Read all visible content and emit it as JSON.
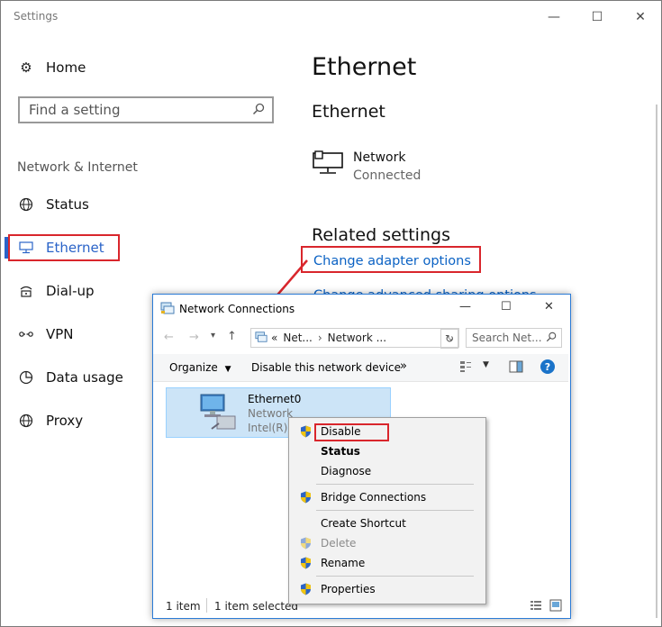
{
  "window": {
    "title": "Settings",
    "minimize": "—",
    "maximize": "☐",
    "close": "✕"
  },
  "sidebar": {
    "home_label": "Home",
    "search_placeholder": "Find a setting",
    "section_title": "Network & Internet",
    "items": [
      {
        "label": "Status",
        "icon": "globe-status-icon"
      },
      {
        "label": "Ethernet",
        "icon": "ethernet-icon",
        "selected": true
      },
      {
        "label": "Dial-up",
        "icon": "dialup-icon"
      },
      {
        "label": "VPN",
        "icon": "vpn-icon"
      },
      {
        "label": "Data usage",
        "icon": "data-usage-icon"
      },
      {
        "label": "Proxy",
        "icon": "globe-icon"
      }
    ]
  },
  "main": {
    "page_title": "Ethernet",
    "section_title": "Ethernet",
    "network_name": "Network",
    "network_status": "Connected",
    "related_title": "Related settings",
    "change_adapter_link": "Change adapter options",
    "partial_link": "Change advanced sharing options"
  },
  "network_connections": {
    "title": "Network Connections",
    "address_sep": "«",
    "address_parts": [
      "Net...",
      "Network ..."
    ],
    "search_placeholder": "Search Net...",
    "organize_label": "Organize",
    "disable_device_label": "Disable this network device",
    "more_label": "»",
    "adapter_name": "Ethernet0",
    "adapter_network": "Network",
    "adapter_device": "Intel(R) P",
    "status_count": "1 item",
    "status_selected": "1 item selected"
  },
  "context_menu": {
    "items": [
      {
        "label": "Disable",
        "shield": true
      },
      {
        "label": "Status",
        "bold": true
      },
      {
        "label": "Diagnose"
      },
      {
        "label": "Bridge Connections",
        "shield": true
      },
      {
        "label": "Create Shortcut"
      },
      {
        "label": "Delete",
        "shield": true,
        "disabled": true
      },
      {
        "label": "Rename",
        "shield": true
      },
      {
        "label": "Properties",
        "shield": true
      }
    ]
  },
  "colors": {
    "accent": "#2a63c8",
    "link": "#0b62c4",
    "highlight_box": "#d9262c",
    "selection": "#cce4f7"
  }
}
